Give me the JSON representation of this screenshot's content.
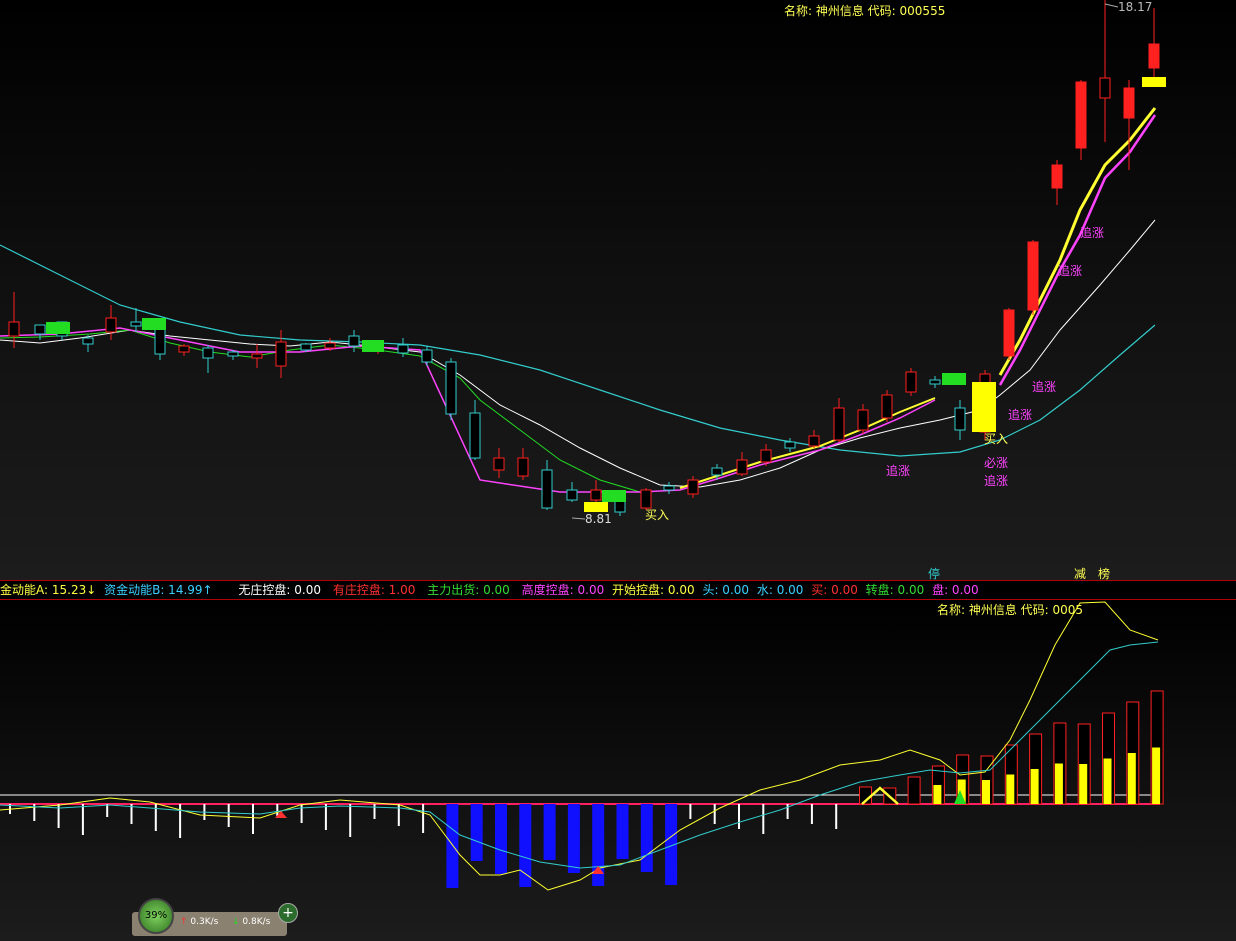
{
  "main_title": "名称: 神州信息  代码: 000555",
  "sub_title": "名称: 神州信息  代码: 0005",
  "price_high_label": "18.17",
  "price_low_label": "8.81",
  "signals": {
    "buy1": "买入",
    "buy2": "买入",
    "must_rise": "必涨",
    "chase": "追涨",
    "stop": "停",
    "reduce": "减",
    "rank": "榜"
  },
  "status_items": [
    {
      "text": "金动能A: 15.23↓",
      "color": "#ffff44"
    },
    {
      "text": "资金动能B: 14.99↑",
      "color": "#3ad0ff"
    },
    {
      "text": "无庄控盘: 0.00",
      "color": "#ffffff"
    },
    {
      "text": "有庄控盘: 1.00",
      "color": "#ff3030"
    },
    {
      "text": "主力出货: 0.00",
      "color": "#33dd33"
    },
    {
      "text": "高度控盘: 0.00",
      "color": "#ff44ff"
    },
    {
      "text": "开始控盘: 0.00",
      "color": "#ffff44"
    },
    {
      "text": "头: 0.00",
      "color": "#3ad0ff"
    },
    {
      "text": "水: 0.00",
      "color": "#3ad0ff"
    },
    {
      "text": "买: 0.00",
      "color": "#ff3030"
    },
    {
      "text": "转盘: 0.00",
      "color": "#33dd33"
    },
    {
      "text": "盘: 0.00",
      "color": "#ff44ff"
    }
  ],
  "widget": {
    "percent": "39%",
    "upload": "0.3K/s",
    "download": "0.8K/s"
  },
  "colors": {
    "rise": "#ff2020",
    "fall": "#33cccc",
    "ma_short": "#ffffff",
    "ma_long": "#33cccc",
    "signal_yellow": "#ffff00",
    "signal_magenta": "#ff33ff",
    "bar_blue": "#1010ff"
  }
}
